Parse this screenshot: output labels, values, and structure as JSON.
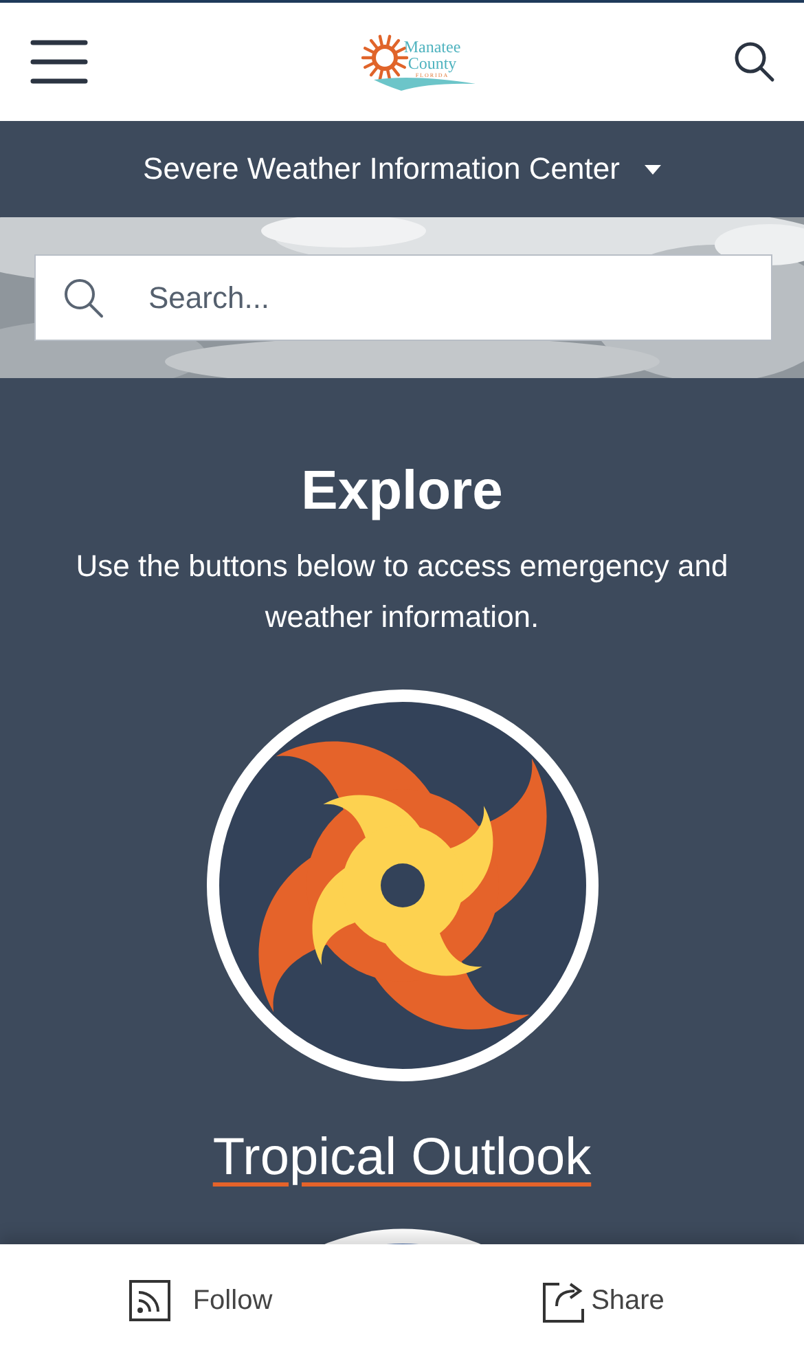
{
  "header": {
    "logo": {
      "lines": [
        "Manatee",
        "County",
        "FLORIDA"
      ]
    }
  },
  "nav": {
    "title": "Severe Weather Information Center"
  },
  "search": {
    "placeholder": "Search..."
  },
  "explore": {
    "title": "Explore",
    "description": "Use the buttons below to access emergency and weather information.",
    "buttons": [
      {
        "kind": "hurricane",
        "label": "Tropical Outlook"
      },
      {
        "kind": "partial"
      }
    ]
  },
  "footer": {
    "actions": [
      {
        "kind": "rss",
        "label": "Follow"
      },
      {
        "kind": "share",
        "label": "Share"
      }
    ]
  }
}
